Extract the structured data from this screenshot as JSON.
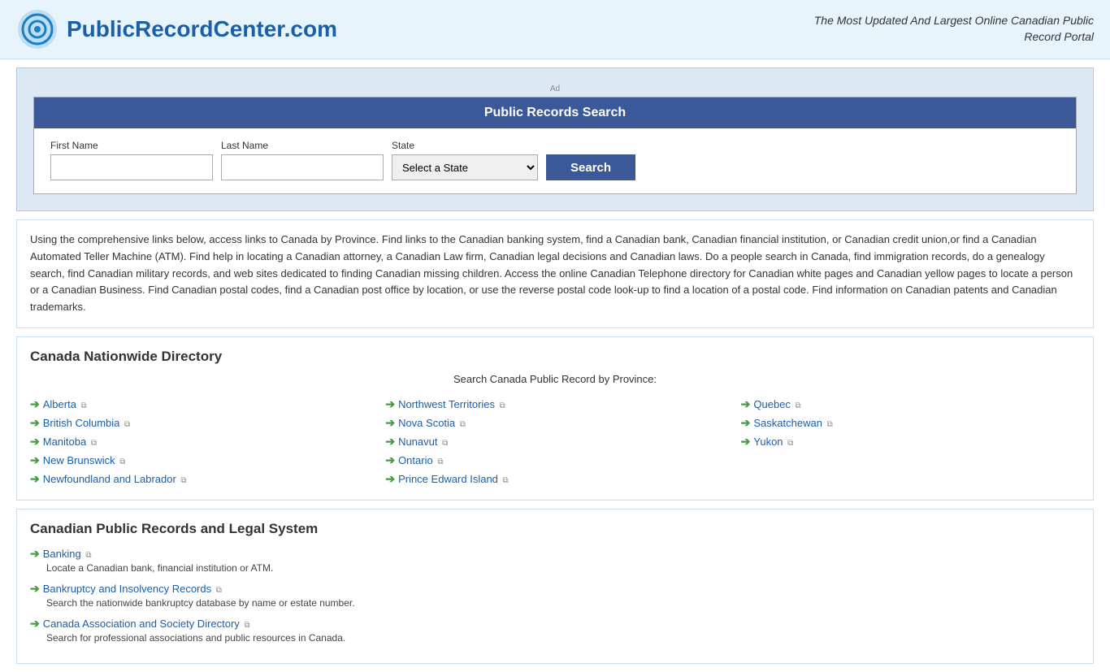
{
  "header": {
    "logo_text": "PublicRecordCenter.com",
    "tagline": "The Most Updated And Largest Online Canadian Public Record Portal"
  },
  "ad_label": "Ad",
  "search_box": {
    "title": "Public Records Search",
    "first_name_label": "First Name",
    "last_name_label": "Last Name",
    "state_label": "State",
    "state_placeholder": "Select a State",
    "search_button": "Search",
    "state_options": [
      "Select a State",
      "Alberta",
      "British Columbia",
      "Manitoba",
      "New Brunswick",
      "Newfoundland and Labrador",
      "Northwest Territories",
      "Nova Scotia",
      "Nunavut",
      "Ontario",
      "Prince Edward Island",
      "Quebec",
      "Saskatchewan",
      "Yukon"
    ]
  },
  "description": "Using the comprehensive links below, access links to Canada by Province. Find links to the Canadian banking system, find a Canadian bank, Canadian financial institution, or Canadian credit union,or find a Canadian Automated Teller Machine (ATM). Find help in locating a Canadian attorney, a Canadian Law firm, Canadian legal decisions and Canadian laws. Do a people search in Canada, find immigration records, do a genealogy search, find Canadian military records, and web sites dedicated to finding Canadian missing children. Access the online Canadian Telephone directory for Canadian white pages and Canadian yellow pages to locate a person or a Canadian Business. Find Canadian postal codes, find a Canadian post office by location, or use the reverse postal code look-up to find a location of a postal code. Find information on Canadian patents and Canadian trademarks.",
  "directory": {
    "title": "Canada Nationwide Directory",
    "subtitle": "Search Canada Public Record by Province:",
    "provinces": [
      {
        "col": 0,
        "name": "Alberta",
        "href": "#"
      },
      {
        "col": 0,
        "name": "British Columbia",
        "href": "#"
      },
      {
        "col": 0,
        "name": "Manitoba",
        "href": "#"
      },
      {
        "col": 0,
        "name": "New Brunswick",
        "href": "#"
      },
      {
        "col": 0,
        "name": "Newfoundland and Labrador",
        "href": "#"
      },
      {
        "col": 1,
        "name": "Northwest Territories",
        "href": "#"
      },
      {
        "col": 1,
        "name": "Nova Scotia",
        "href": "#"
      },
      {
        "col": 1,
        "name": "Nunavut",
        "href": "#"
      },
      {
        "col": 1,
        "name": "Ontario",
        "href": "#"
      },
      {
        "col": 1,
        "name": "Prince Edward Island",
        "href": "#"
      },
      {
        "col": 2,
        "name": "Quebec",
        "href": "#"
      },
      {
        "col": 2,
        "name": "Saskatchewan",
        "href": "#"
      },
      {
        "col": 2,
        "name": "Yukon",
        "href": "#"
      }
    ]
  },
  "legal_section": {
    "title": "Canadian Public Records and Legal System",
    "items": [
      {
        "name": "Banking",
        "href": "#",
        "description": "Locate a Canadian bank, financial institution or ATM."
      },
      {
        "name": "Bankruptcy and Insolvency Records",
        "href": "#",
        "description": "Search the nationwide bankruptcy database by name or estate number."
      },
      {
        "name": "Canada Association and Society Directory",
        "href": "#",
        "description": "Search for professional associations and public resources in Canada."
      }
    ]
  }
}
